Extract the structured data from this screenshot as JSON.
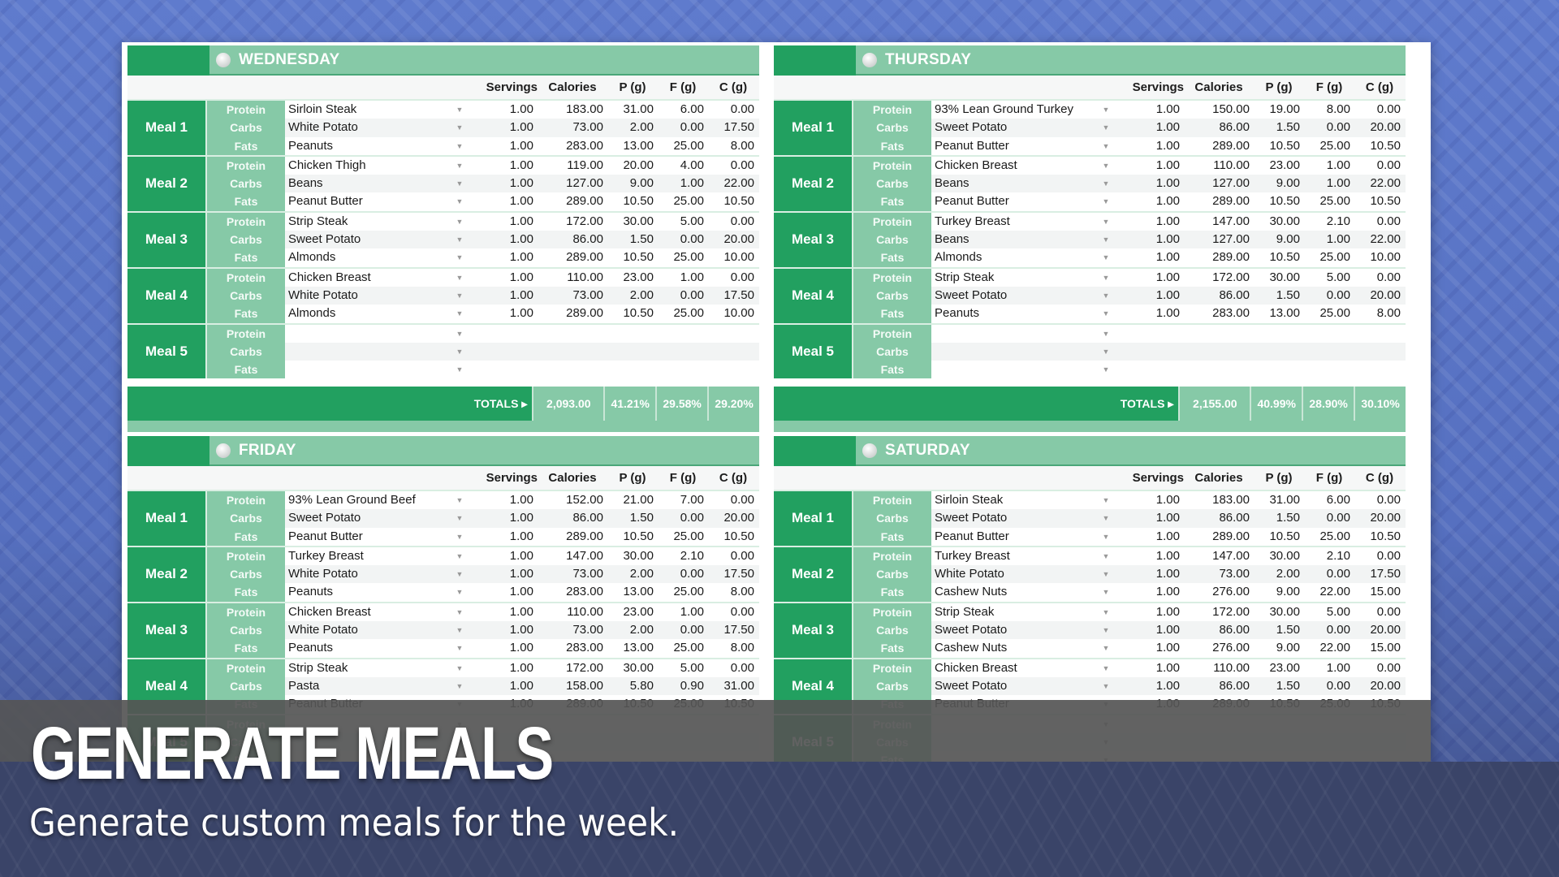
{
  "columns": {
    "servings": "Servings",
    "calories": "Calories",
    "p": "P (g)",
    "f": "F (g)",
    "c": "C (g)"
  },
  "macro_labels": [
    "Protein",
    "Carbs",
    "Fats"
  ],
  "totals_label": "TOTALS ▸",
  "dropdown_icon": "▼",
  "days": [
    {
      "name": "WEDNESDAY",
      "meals": [
        {
          "label": "Meal 1",
          "rows": [
            {
              "food": "Sirloin Steak",
              "servings": "1.00",
              "calories": "183.00",
              "p": "31.00",
              "f": "6.00",
              "c": "0.00"
            },
            {
              "food": "White Potato",
              "servings": "1.00",
              "calories": "73.00",
              "p": "2.00",
              "f": "0.00",
              "c": "17.50"
            },
            {
              "food": "Peanuts",
              "servings": "1.00",
              "calories": "283.00",
              "p": "13.00",
              "f": "25.00",
              "c": "8.00"
            }
          ]
        },
        {
          "label": "Meal 2",
          "rows": [
            {
              "food": "Chicken Thigh",
              "servings": "1.00",
              "calories": "119.00",
              "p": "20.00",
              "f": "4.00",
              "c": "0.00"
            },
            {
              "food": "Beans",
              "servings": "1.00",
              "calories": "127.00",
              "p": "9.00",
              "f": "1.00",
              "c": "22.00"
            },
            {
              "food": "Peanut Butter",
              "servings": "1.00",
              "calories": "289.00",
              "p": "10.50",
              "f": "25.00",
              "c": "10.50"
            }
          ]
        },
        {
          "label": "Meal 3",
          "rows": [
            {
              "food": "Strip Steak",
              "servings": "1.00",
              "calories": "172.00",
              "p": "30.00",
              "f": "5.00",
              "c": "0.00"
            },
            {
              "food": "Sweet Potato",
              "servings": "1.00",
              "calories": "86.00",
              "p": "1.50",
              "f": "0.00",
              "c": "20.00"
            },
            {
              "food": "Almonds",
              "servings": "1.00",
              "calories": "289.00",
              "p": "10.50",
              "f": "25.00",
              "c": "10.00"
            }
          ]
        },
        {
          "label": "Meal 4",
          "rows": [
            {
              "food": "Chicken Breast",
              "servings": "1.00",
              "calories": "110.00",
              "p": "23.00",
              "f": "1.00",
              "c": "0.00"
            },
            {
              "food": "White Potato",
              "servings": "1.00",
              "calories": "73.00",
              "p": "2.00",
              "f": "0.00",
              "c": "17.50"
            },
            {
              "food": "Almonds",
              "servings": "1.00",
              "calories": "289.00",
              "p": "10.50",
              "f": "25.00",
              "c": "10.00"
            }
          ]
        },
        {
          "label": "Meal 5",
          "rows": [
            {
              "food": "",
              "servings": "",
              "calories": "",
              "p": "",
              "f": "",
              "c": ""
            },
            {
              "food": "",
              "servings": "",
              "calories": "",
              "p": "",
              "f": "",
              "c": ""
            },
            {
              "food": "",
              "servings": "",
              "calories": "",
              "p": "",
              "f": "",
              "c": ""
            }
          ]
        }
      ],
      "totals": {
        "calories": "2,093.00",
        "p": "41.21%",
        "f": "29.58%",
        "c": "29.20%"
      }
    },
    {
      "name": "THURSDAY",
      "meals": [
        {
          "label": "Meal 1",
          "rows": [
            {
              "food": "93% Lean Ground Turkey",
              "servings": "1.00",
              "calories": "150.00",
              "p": "19.00",
              "f": "8.00",
              "c": "0.00"
            },
            {
              "food": "Sweet Potato",
              "servings": "1.00",
              "calories": "86.00",
              "p": "1.50",
              "f": "0.00",
              "c": "20.00"
            },
            {
              "food": "Peanut Butter",
              "servings": "1.00",
              "calories": "289.00",
              "p": "10.50",
              "f": "25.00",
              "c": "10.50"
            }
          ]
        },
        {
          "label": "Meal 2",
          "rows": [
            {
              "food": "Chicken Breast",
              "servings": "1.00",
              "calories": "110.00",
              "p": "23.00",
              "f": "1.00",
              "c": "0.00"
            },
            {
              "food": "Beans",
              "servings": "1.00",
              "calories": "127.00",
              "p": "9.00",
              "f": "1.00",
              "c": "22.00"
            },
            {
              "food": "Peanut Butter",
              "servings": "1.00",
              "calories": "289.00",
              "p": "10.50",
              "f": "25.00",
              "c": "10.50"
            }
          ]
        },
        {
          "label": "Meal 3",
          "rows": [
            {
              "food": "Turkey Breast",
              "servings": "1.00",
              "calories": "147.00",
              "p": "30.00",
              "f": "2.10",
              "c": "0.00"
            },
            {
              "food": "Beans",
              "servings": "1.00",
              "calories": "127.00",
              "p": "9.00",
              "f": "1.00",
              "c": "22.00"
            },
            {
              "food": "Almonds",
              "servings": "1.00",
              "calories": "289.00",
              "p": "10.50",
              "f": "25.00",
              "c": "10.00"
            }
          ]
        },
        {
          "label": "Meal 4",
          "rows": [
            {
              "food": "Strip Steak",
              "servings": "1.00",
              "calories": "172.00",
              "p": "30.00",
              "f": "5.00",
              "c": "0.00"
            },
            {
              "food": "Sweet Potato",
              "servings": "1.00",
              "calories": "86.00",
              "p": "1.50",
              "f": "0.00",
              "c": "20.00"
            },
            {
              "food": "Peanuts",
              "servings": "1.00",
              "calories": "283.00",
              "p": "13.00",
              "f": "25.00",
              "c": "8.00"
            }
          ]
        },
        {
          "label": "Meal 5",
          "rows": [
            {
              "food": "",
              "servings": "",
              "calories": "",
              "p": "",
              "f": "",
              "c": ""
            },
            {
              "food": "",
              "servings": "",
              "calories": "",
              "p": "",
              "f": "",
              "c": ""
            },
            {
              "food": "",
              "servings": "",
              "calories": "",
              "p": "",
              "f": "",
              "c": ""
            }
          ]
        }
      ],
      "totals": {
        "calories": "2,155.00",
        "p": "40.99%",
        "f": "28.90%",
        "c": "30.10%"
      }
    },
    {
      "name": "FRIDAY",
      "meals": [
        {
          "label": "Meal 1",
          "rows": [
            {
              "food": "93% Lean Ground Beef",
              "servings": "1.00",
              "calories": "152.00",
              "p": "21.00",
              "f": "7.00",
              "c": "0.00"
            },
            {
              "food": "Sweet Potato",
              "servings": "1.00",
              "calories": "86.00",
              "p": "1.50",
              "f": "0.00",
              "c": "20.00"
            },
            {
              "food": "Peanut Butter",
              "servings": "1.00",
              "calories": "289.00",
              "p": "10.50",
              "f": "25.00",
              "c": "10.50"
            }
          ]
        },
        {
          "label": "Meal 2",
          "rows": [
            {
              "food": "Turkey Breast",
              "servings": "1.00",
              "calories": "147.00",
              "p": "30.00",
              "f": "2.10",
              "c": "0.00"
            },
            {
              "food": "White Potato",
              "servings": "1.00",
              "calories": "73.00",
              "p": "2.00",
              "f": "0.00",
              "c": "17.50"
            },
            {
              "food": "Peanuts",
              "servings": "1.00",
              "calories": "283.00",
              "p": "13.00",
              "f": "25.00",
              "c": "8.00"
            }
          ]
        },
        {
          "label": "Meal 3",
          "rows": [
            {
              "food": "Chicken Breast",
              "servings": "1.00",
              "calories": "110.00",
              "p": "23.00",
              "f": "1.00",
              "c": "0.00"
            },
            {
              "food": "White Potato",
              "servings": "1.00",
              "calories": "73.00",
              "p": "2.00",
              "f": "0.00",
              "c": "17.50"
            },
            {
              "food": "Peanuts",
              "servings": "1.00",
              "calories": "283.00",
              "p": "13.00",
              "f": "25.00",
              "c": "8.00"
            }
          ]
        },
        {
          "label": "Meal 4",
          "rows": [
            {
              "food": "Strip Steak",
              "servings": "1.00",
              "calories": "172.00",
              "p": "30.00",
              "f": "5.00",
              "c": "0.00"
            },
            {
              "food": "Pasta",
              "servings": "1.00",
              "calories": "158.00",
              "p": "5.80",
              "f": "0.90",
              "c": "31.00"
            },
            {
              "food": "Peanut Butter",
              "servings": "1.00",
              "calories": "289.00",
              "p": "10.50",
              "f": "25.00",
              "c": "10.50"
            }
          ]
        },
        {
          "label": "Meal 5",
          "rows": [
            {
              "food": "",
              "servings": "",
              "calories": "",
              "p": "",
              "f": "",
              "c": ""
            },
            {
              "food": "",
              "servings": "",
              "calories": "",
              "p": "",
              "f": "",
              "c": ""
            },
            {
              "food": "",
              "servings": "",
              "calories": "",
              "p": "",
              "f": "",
              "c": ""
            }
          ]
        }
      ]
    },
    {
      "name": "SATURDAY",
      "meals": [
        {
          "label": "Meal 1",
          "rows": [
            {
              "food": "Sirloin Steak",
              "servings": "1.00",
              "calories": "183.00",
              "p": "31.00",
              "f": "6.00",
              "c": "0.00"
            },
            {
              "food": "Sweet Potato",
              "servings": "1.00",
              "calories": "86.00",
              "p": "1.50",
              "f": "0.00",
              "c": "20.00"
            },
            {
              "food": "Peanut Butter",
              "servings": "1.00",
              "calories": "289.00",
              "p": "10.50",
              "f": "25.00",
              "c": "10.50"
            }
          ]
        },
        {
          "label": "Meal 2",
          "rows": [
            {
              "food": "Turkey Breast",
              "servings": "1.00",
              "calories": "147.00",
              "p": "30.00",
              "f": "2.10",
              "c": "0.00"
            },
            {
              "food": "White Potato",
              "servings": "1.00",
              "calories": "73.00",
              "p": "2.00",
              "f": "0.00",
              "c": "17.50"
            },
            {
              "food": "Cashew Nuts",
              "servings": "1.00",
              "calories": "276.00",
              "p": "9.00",
              "f": "22.00",
              "c": "15.00"
            }
          ]
        },
        {
          "label": "Meal 3",
          "rows": [
            {
              "food": "Strip Steak",
              "servings": "1.00",
              "calories": "172.00",
              "p": "30.00",
              "f": "5.00",
              "c": "0.00"
            },
            {
              "food": "Sweet Potato",
              "servings": "1.00",
              "calories": "86.00",
              "p": "1.50",
              "f": "0.00",
              "c": "20.00"
            },
            {
              "food": "Cashew Nuts",
              "servings": "1.00",
              "calories": "276.00",
              "p": "9.00",
              "f": "22.00",
              "c": "15.00"
            }
          ]
        },
        {
          "label": "Meal 4",
          "rows": [
            {
              "food": "Chicken Breast",
              "servings": "1.00",
              "calories": "110.00",
              "p": "23.00",
              "f": "1.00",
              "c": "0.00"
            },
            {
              "food": "Sweet Potato",
              "servings": "1.00",
              "calories": "86.00",
              "p": "1.50",
              "f": "0.00",
              "c": "20.00"
            },
            {
              "food": "Peanut Butter",
              "servings": "1.00",
              "calories": "289.00",
              "p": "10.50",
              "f": "25.00",
              "c": "10.50"
            }
          ]
        },
        {
          "label": "Meal 5",
          "rows": [
            {
              "food": "",
              "servings": "",
              "calories": "",
              "p": "",
              "f": "",
              "c": ""
            },
            {
              "food": "",
              "servings": "",
              "calories": "",
              "p": "",
              "f": "",
              "c": ""
            },
            {
              "food": "",
              "servings": "",
              "calories": "",
              "p": "",
              "f": "",
              "c": ""
            }
          ]
        }
      ]
    }
  ],
  "caption": {
    "headline": "GENERATE MEALS",
    "subline": "Generate custom meals for the week."
  }
}
